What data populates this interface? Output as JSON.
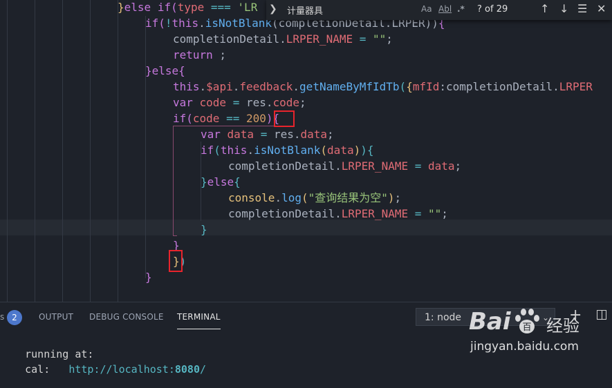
{
  "editor": {
    "lines": [
      [
        {
          "t": "}",
          "c": "br1"
        },
        {
          "t": "else ",
          "c": "kw"
        },
        {
          "t": "if",
          "c": "kw"
        },
        {
          "t": "(",
          "c": "br2"
        },
        {
          "t": "type",
          "c": "prop"
        },
        {
          "t": " === ",
          "c": "cyan"
        },
        {
          "t": "'LR",
          "c": "str"
        }
      ],
      [
        {
          "t": "if",
          "c": "kw"
        },
        {
          "t": "(",
          "c": "br2"
        },
        {
          "t": "!",
          "c": "cyan"
        },
        {
          "t": "this",
          "c": "kw"
        },
        {
          "t": ".",
          "c": "punc"
        },
        {
          "t": "isNotBlank",
          "c": "fn"
        },
        {
          "t": "(completionDetail.LRPER))",
          "c": "txt"
        },
        {
          "t": "{",
          "c": "br2"
        }
      ],
      [
        {
          "t": "completionDetail.",
          "c": "txt"
        },
        {
          "t": "LRPER_NAME",
          "c": "prop"
        },
        {
          "t": " = ",
          "c": "cyan"
        },
        {
          "t": "\"\"",
          "c": "str"
        },
        {
          "t": ";",
          "c": "punc"
        }
      ],
      [
        {
          "t": "return",
          "c": "kw"
        },
        {
          "t": " ;",
          "c": "punc"
        }
      ],
      [
        {
          "t": "}",
          "c": "br2"
        },
        {
          "t": "else",
          "c": "kw"
        },
        {
          "t": "{",
          "c": "br2"
        }
      ],
      [
        {
          "t": "this",
          "c": "kw"
        },
        {
          "t": ".",
          "c": "punc"
        },
        {
          "t": "$api",
          "c": "prop"
        },
        {
          "t": ".",
          "c": "punc"
        },
        {
          "t": "feedback",
          "c": "prop"
        },
        {
          "t": ".",
          "c": "punc"
        },
        {
          "t": "getNameByMfIdTb",
          "c": "fn"
        },
        {
          "t": "(",
          "c": "br3"
        },
        {
          "t": "{",
          "c": "br1"
        },
        {
          "t": "mfId",
          "c": "prop"
        },
        {
          "t": ":completionDetail.",
          "c": "txt"
        },
        {
          "t": "LRPER",
          "c": "prop"
        }
      ],
      [
        {
          "t": "var ",
          "c": "kw"
        },
        {
          "t": "code",
          "c": "prop"
        },
        {
          "t": " = ",
          "c": "cyan"
        },
        {
          "t": "res.",
          "c": "txt"
        },
        {
          "t": "code",
          "c": "prop"
        },
        {
          "t": ";",
          "c": "punc"
        }
      ],
      [
        {
          "t": "if",
          "c": "kw"
        },
        {
          "t": "(",
          "c": "br2"
        },
        {
          "t": "code",
          "c": "prop"
        },
        {
          "t": " == ",
          "c": "cyan"
        },
        {
          "t": "200",
          "c": "num"
        },
        {
          "t": ")",
          "c": "br2"
        },
        {
          "t": "{",
          "c": "br2"
        }
      ],
      [
        {
          "t": "var ",
          "c": "kw"
        },
        {
          "t": "data",
          "c": "prop"
        },
        {
          "t": " = ",
          "c": "cyan"
        },
        {
          "t": "res.",
          "c": "txt"
        },
        {
          "t": "data",
          "c": "prop"
        },
        {
          "t": ";",
          "c": "punc"
        }
      ],
      [
        {
          "t": "if",
          "c": "kw"
        },
        {
          "t": "(",
          "c": "br3"
        },
        {
          "t": "this",
          "c": "kw"
        },
        {
          "t": ".",
          "c": "punc"
        },
        {
          "t": "isNotBlank",
          "c": "fn"
        },
        {
          "t": "(",
          "c": "br1"
        },
        {
          "t": "data",
          "c": "prop"
        },
        {
          "t": ")",
          "c": "br1"
        },
        {
          "t": ")",
          "c": "br3"
        },
        {
          "t": "{",
          "c": "br3"
        }
      ],
      [
        {
          "t": "completionDetail.",
          "c": "txt"
        },
        {
          "t": "LRPER_NAME",
          "c": "prop"
        },
        {
          "t": " = ",
          "c": "cyan"
        },
        {
          "t": "data",
          "c": "prop"
        },
        {
          "t": ";",
          "c": "punc"
        }
      ],
      [
        {
          "t": "}",
          "c": "br3"
        },
        {
          "t": "else",
          "c": "kw"
        },
        {
          "t": "{",
          "c": "br3"
        }
      ],
      [
        {
          "t": "console",
          "c": "br1"
        },
        {
          "t": ".",
          "c": "punc"
        },
        {
          "t": "log",
          "c": "fn"
        },
        {
          "t": "(",
          "c": "br1"
        },
        {
          "t": "\"查询结果为空\"",
          "c": "str"
        },
        {
          "t": ")",
          "c": "br1"
        },
        {
          "t": ";",
          "c": "punc"
        }
      ],
      [
        {
          "t": "completionDetail.",
          "c": "txt"
        },
        {
          "t": "LRPER_NAME",
          "c": "prop"
        },
        {
          "t": " = ",
          "c": "cyan"
        },
        {
          "t": "\"\"",
          "c": "str"
        },
        {
          "t": ";",
          "c": "punc"
        }
      ],
      [
        {
          "t": "}",
          "c": "br3"
        }
      ],
      [
        {
          "t": "}",
          "c": "br2"
        }
      ],
      [
        {
          "t": "}",
          "c": "br1"
        },
        {
          "t": ")",
          "c": "br3"
        }
      ],
      [
        {
          "t": "}",
          "c": "br2"
        }
      ]
    ]
  },
  "find": {
    "query": "计量器具",
    "match_case": "Aa",
    "whole_word": "Abl",
    "regex": ".*",
    "count": "? of 29",
    "toggle_icon": "chevron-right-icon",
    "prev_icon": "arrow-up-icon",
    "next_icon": "arrow-down-icon",
    "selection_icon": "find-in-selection-icon"
  },
  "panel": {
    "problems_count": "2",
    "tabs": [
      "OUTPUT",
      "DEBUG CONSOLE",
      "TERMINAL"
    ],
    "terminal_select": "1: node",
    "terminal_lines": {
      "line1": "running at:",
      "local_label": "cal:",
      "local_url": "http://localhost:",
      "local_port": "8080",
      "local_slash": "/"
    }
  },
  "watermark": {
    "brand_left": "Bai",
    "brand_right": "百",
    "brand_suffix": "经验",
    "site": "jingyan.baidu.com"
  }
}
